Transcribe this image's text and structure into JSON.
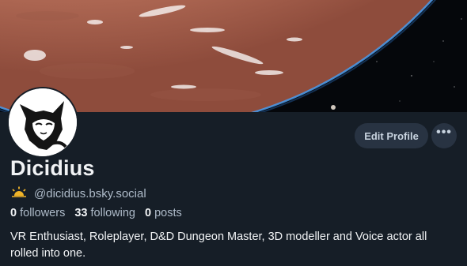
{
  "profile": {
    "display_name": "Dicidius",
    "handle": "@dicidius.bsky.social",
    "edit_label": "Edit Profile",
    "more_label": "•••",
    "followers_count": "0",
    "followers_label": "followers",
    "following_count": "33",
    "following_label": "following",
    "posts_count": "0",
    "posts_label": "posts",
    "bio": "VR Enthusiast, Roleplayer, D&D Dungeon Master, 3D modeller and Voice actor all rolled into one."
  },
  "icons": {
    "handle_badge": "sunrise-icon",
    "more": "more-dots-icon"
  },
  "colors": {
    "background": "#161e27",
    "button_bg": "#283342",
    "muted_text": "#aebbc9",
    "badge": "#f0b429"
  }
}
